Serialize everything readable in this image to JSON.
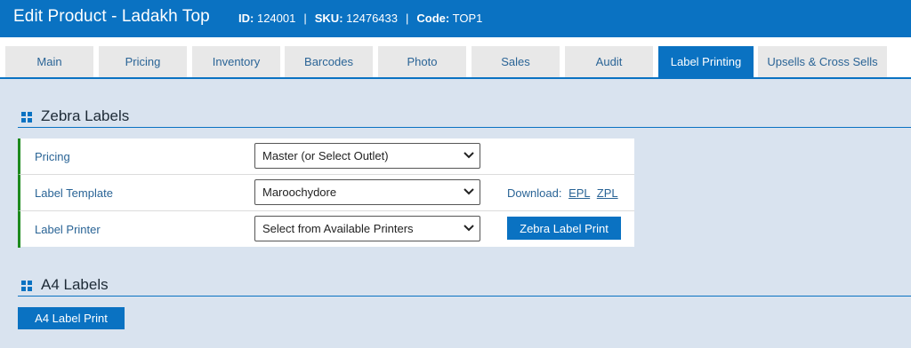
{
  "header": {
    "title": "Edit Product - Ladakh Top",
    "id_label": "ID:",
    "id_value": "124001",
    "sku_label": "SKU:",
    "sku_value": "12476433",
    "code_label": "Code:",
    "code_value": "TOP1",
    "separator": "|"
  },
  "tabs": [
    {
      "label": "Main"
    },
    {
      "label": "Pricing"
    },
    {
      "label": "Inventory"
    },
    {
      "label": "Barcodes"
    },
    {
      "label": "Photo"
    },
    {
      "label": "Sales"
    },
    {
      "label": "Audit"
    },
    {
      "label": "Label Printing",
      "active": true
    },
    {
      "label": "Upsells & Cross Sells"
    }
  ],
  "zebra": {
    "title": "Zebra Labels",
    "rows": [
      {
        "label": "Pricing",
        "value": "Master (or Select Outlet)"
      },
      {
        "label": "Label Template",
        "value": "Maroochydore"
      },
      {
        "label": "Label Printer",
        "value": "Select from Available Printers"
      }
    ],
    "download_label": "Download:",
    "download_links": [
      "EPL",
      "ZPL"
    ],
    "print_button": "Zebra Label Print"
  },
  "a4": {
    "title": "A4 Labels",
    "print_button": "A4 Label Print"
  },
  "colors": {
    "accent": "#0a72c2",
    "page_bg": "#d9e3ef",
    "row_marker": "#1e8a1e",
    "link": "#2a6496"
  },
  "icons": {
    "section": "grid-icon",
    "select": "chevron-down-icon"
  }
}
